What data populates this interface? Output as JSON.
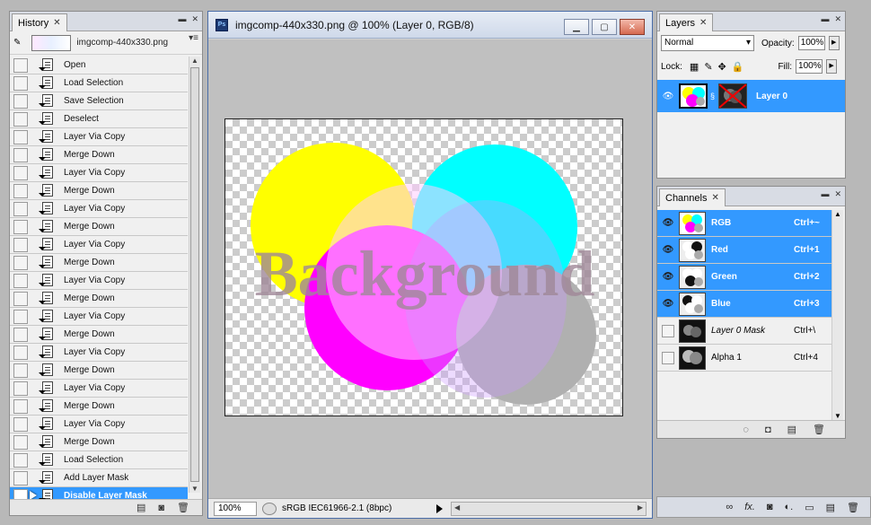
{
  "history": {
    "tab_label": "History",
    "snapshot_label": "imgcomp-440x330.png",
    "items": [
      {
        "label": "Open"
      },
      {
        "label": "Load Selection"
      },
      {
        "label": "Save Selection"
      },
      {
        "label": "Deselect"
      },
      {
        "label": "Layer Via Copy"
      },
      {
        "label": "Merge Down"
      },
      {
        "label": "Layer Via Copy"
      },
      {
        "label": "Merge Down"
      },
      {
        "label": "Layer Via Copy"
      },
      {
        "label": "Merge Down"
      },
      {
        "label": "Layer Via Copy"
      },
      {
        "label": "Merge Down"
      },
      {
        "label": "Layer Via Copy"
      },
      {
        "label": "Merge Down"
      },
      {
        "label": "Layer Via Copy"
      },
      {
        "label": "Merge Down"
      },
      {
        "label": "Layer Via Copy"
      },
      {
        "label": "Merge Down"
      },
      {
        "label": "Layer Via Copy"
      },
      {
        "label": "Merge Down"
      },
      {
        "label": "Layer Via Copy"
      },
      {
        "label": "Merge Down"
      },
      {
        "label": "Load Selection"
      },
      {
        "label": "Add Layer Mask"
      },
      {
        "label": "Disable Layer Mask",
        "selected": true
      }
    ]
  },
  "document": {
    "title": "imgcomp-440x330.png @ 100% (Layer 0, RGB/8)",
    "ps_icon_text": "Ps",
    "zoom": "100%",
    "profile": "sRGB IEC61966-2.1 (8bpc)",
    "overlay_text": "Background",
    "colors": {
      "yellow": "#ffff00",
      "cyan": "#00ffff",
      "magenta": "#ff00ff",
      "gray": "#b0b0b0"
    }
  },
  "layers": {
    "tab_label": "Layers",
    "blend_mode": "Normal",
    "opacity_label": "Opacity:",
    "opacity": "100%",
    "lock_label": "Lock:",
    "fill_label": "Fill:",
    "fill": "100%",
    "items": [
      {
        "name": "Layer 0",
        "selected": true
      }
    ]
  },
  "channels": {
    "tab_label": "Channels",
    "items": [
      {
        "name": "RGB",
        "shortcut": "Ctrl+~",
        "visible": true,
        "selected": true
      },
      {
        "name": "Red",
        "shortcut": "Ctrl+1",
        "visible": true,
        "selected": true
      },
      {
        "name": "Green",
        "shortcut": "Ctrl+2",
        "visible": true,
        "selected": true
      },
      {
        "name": "Blue",
        "shortcut": "Ctrl+3",
        "visible": true,
        "selected": true
      },
      {
        "name": "Layer 0 Mask",
        "shortcut": "Ctrl+\\",
        "visible": false,
        "selected": false,
        "italic": true
      },
      {
        "name": "Alpha 1",
        "shortcut": "Ctrl+4",
        "visible": false,
        "selected": false
      }
    ]
  },
  "accent_color": "#3399ff"
}
